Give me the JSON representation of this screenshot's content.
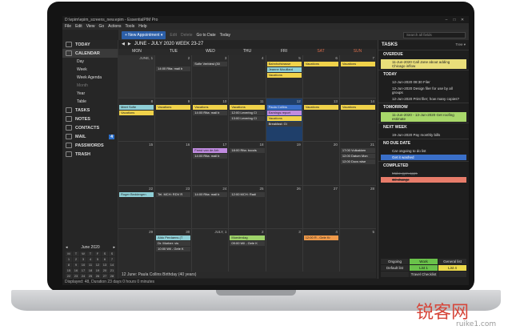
{
  "window": {
    "title": "D:\\epim\\epim_screens_new.epim - EssentialPIM Pro"
  },
  "menu": [
    "File",
    "Edit",
    "View",
    "Go",
    "Actions",
    "Tools",
    "Help"
  ],
  "toolbar": {
    "new": "+ New Appointment ▾",
    "edit": "Edit",
    "delete": "Delete",
    "goto": "Go to Date",
    "today": "Today",
    "search_placeholder": "Search all fields"
  },
  "sidebar": {
    "today": "TODAY",
    "calendar": "CALENDAR",
    "views": [
      "Day",
      "Week",
      "Week Agenda",
      "Month",
      "Year",
      "Table"
    ],
    "tasks": "TASKS",
    "notes": "NOTES",
    "contacts": "CONTACTS",
    "mail": "MAIL",
    "mail_badge": "4",
    "passwords": "PASSWORDS",
    "trash": "TRASH"
  },
  "mini_cal": {
    "title": "June 2020",
    "days": [
      "M",
      "T",
      "W",
      "T",
      "F",
      "S",
      "S"
    ],
    "dates": [
      "1",
      "2",
      "3",
      "4",
      "5",
      "6",
      "7",
      "8",
      "9",
      "10",
      "11",
      "12",
      "13",
      "14",
      "15",
      "16",
      "17",
      "18",
      "19",
      "20",
      "21",
      "22",
      "23",
      "24",
      "25",
      "26",
      "27",
      "28",
      "29",
      "30",
      "1",
      "2",
      "3",
      "4",
      "5"
    ]
  },
  "calendar": {
    "header": "JUNE - JULY 2020   WEEK 23-27",
    "day_names": [
      "MON",
      "TUE",
      "WED",
      "THU",
      "FRI",
      "SAT",
      "SUN"
    ],
    "weeks": [
      [
        "JUNE, 1",
        "2",
        "3",
        "4",
        "5",
        "6",
        "7"
      ],
      [
        "8",
        "9",
        "10",
        "11",
        "12",
        "13",
        "14"
      ],
      [
        "15",
        "16",
        "17",
        "18",
        "19",
        "20",
        "21"
      ],
      [
        "22",
        "23",
        "24",
        "25",
        "26",
        "27",
        "28"
      ],
      [
        "29",
        "30",
        "JULY, 1",
        "2",
        "3",
        "4",
        "5"
      ]
    ],
    "status_row": "12 June:  Paula Collins Birthday  (40 years)"
  },
  "events": {
    "w1": {
      "tue": "14:00 Rita: mail b",
      "wed": "Sofie Verbiest (30",
      "fri1": "Bahnhofstrasse",
      "fri2": "Jeanne Mouillard",
      "sat": "Vacations",
      "sun": "Vacations",
      "fri3": "Vacations"
    },
    "w2": {
      "mon1": "Meet Sofie",
      "mon2": "Vacations",
      "tue": "Vacations",
      "wed1": "Vacations",
      "wed2": "14:00 Rita: mail b",
      "thu1": "Vacations",
      "thu2": "12:00 Levering Cl",
      "thu3": "13:00 Levering Cl",
      "fri1": "Paula Collins",
      "fri2": "Earnings report",
      "fri3": "Vacations",
      "fri4": "Breakfast: Gi",
      "sat": "Vacations",
      "sun": "Vacations"
    },
    "w3": {
      "wed1": "Feest van de Arb",
      "wed2": "14:00 Rita: mail b",
      "thu": "18:00 Rita: boods",
      "sun1": "17:00 Vulkakken",
      "sun2": "12:00 Datum Mon",
      "sun3": "12:00 Docs wise"
    },
    "w4": {
      "mon": "Roger Beddergen",
      "tue": "Tel. MCH: RDV R",
      "wed": "14:00 Rita: mail b",
      "thu": "12:00 MCH: Radi"
    },
    "w5": {
      "tue1": "Aldo Perdaens (T",
      "tue2": "Dr. Morber: vis",
      "tue3": "10:00 Wil - Gele K",
      "thu1": "Moederdag",
      "thu2": "09:00 Wil - Gele K",
      "sat": "12:00 R - Gele Kr"
    }
  },
  "tasks": {
    "title": "TASKS",
    "tree": "Tree ▾",
    "sections": [
      {
        "name": "OVERDUE",
        "items": [
          {
            "text": "11-Jun-2020 Call Jane about adding Chicago inflow",
            "style": "yellow"
          }
        ]
      },
      {
        "name": "TODAY",
        "items": [
          {
            "text": "12-Jun-2020 08:30 Filer",
            "style": ""
          },
          {
            "text": "12-Jun-2020 Design filer for use by all groups",
            "style": ""
          },
          {
            "text": "12-Jun-2020 Print filer; how many copies?",
            "style": ""
          }
        ]
      },
      {
        "name": "TOMORROW",
        "items": [
          {
            "text": "11-Jun-2020 - 13-Jun-2020 Get roofing estimate",
            "style": "green"
          }
        ]
      },
      {
        "name": "NEXT WEEK",
        "items": [
          {
            "text": "19-Jun-2020 Pay monthly bills",
            "style": ""
          }
        ]
      },
      {
        "name": "NO DUE DATE",
        "items": [
          {
            "text": "Car ongoing to do list",
            "style": ""
          },
          {
            "text": "Get it washed",
            "style": "blue"
          }
        ]
      },
      {
        "name": "COMPLETED",
        "items": [
          {
            "text": "Make gym appt.",
            "style": "strike"
          },
          {
            "text": "Oil change",
            "style": "red"
          }
        ]
      }
    ],
    "footer": [
      "Ongoing",
      "Work",
      "General list",
      "Default list",
      "List 1",
      "List 4",
      "",
      "Travel Checklist",
      ""
    ]
  },
  "statusbar": "Displayed: 48, Duration 23 days 0 hours 0 minutes",
  "watermark": {
    "text": "锐客网",
    "sub": "ruike1.com"
  }
}
